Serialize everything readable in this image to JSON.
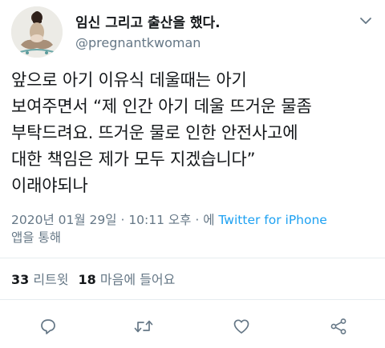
{
  "user": {
    "display_name": "임신 그리고 출산을 했다.",
    "handle": "@pregnantkwoman"
  },
  "tweet": {
    "text": "앞으로 아기 이유식 데울때는 아기\n보여주면서 “제 인간 아기 데울 뜨거운 물좀\n부탁드려요. 뜨거운 물로 인한 안전사고에\n대한 책임은 제가 모두 지겠습니다”\n이래야되나",
    "date": "2020년 01월 29일",
    "sep1": " · ",
    "time": "10:11 오후",
    "sep2": " · 에 ",
    "source": "Twitter for iPhone",
    "via": "앱을 통해"
  },
  "stats": {
    "retweets_count": "33",
    "retweets_label": "리트윗",
    "likes_count": "18",
    "likes_label": "마음에 들어요"
  },
  "icons": {
    "reply": "reply-icon",
    "retweet": "retweet-icon",
    "like": "heart-icon",
    "share": "share-icon",
    "caret": "chevron-down-icon"
  },
  "colors": {
    "text": "#14171a",
    "muted": "#657786",
    "link": "#1da1f2",
    "divider": "#e6ecf0"
  }
}
